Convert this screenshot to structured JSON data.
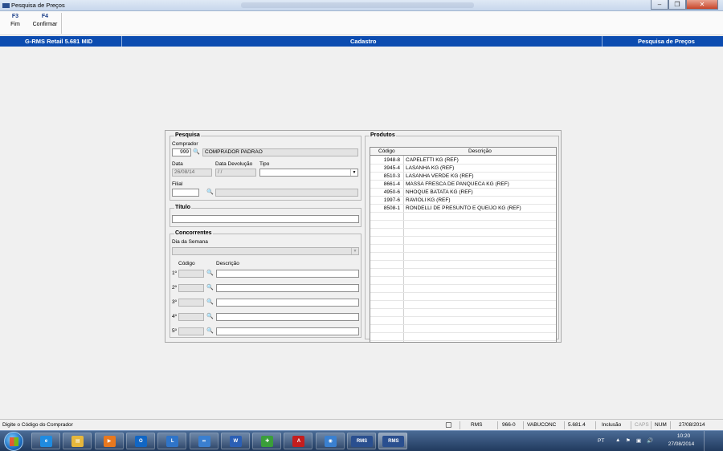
{
  "window": {
    "title": "Pesquisa de Preços"
  },
  "toolbar": {
    "buttons": [
      {
        "key": "F3",
        "label": "Fim"
      },
      {
        "key": "F4",
        "label": "Confirmar"
      }
    ]
  },
  "header": {
    "app": "G-RMS Retail 5.681 MID",
    "module": "Cadastro",
    "screen": "Pesquisa de Preços"
  },
  "pesquisa": {
    "title": "Pesquisa",
    "comprador_label": "Comprador",
    "comprador_code": "999",
    "comprador_name": "COMPRADOR PADRAO",
    "data_label": "Data",
    "data_value": "26/08/14",
    "devolucao_label": "Data Devolução",
    "devolucao_value": " / /",
    "tipo_label": "Tipo",
    "tipo_value": "",
    "filial_label": "Filial",
    "filial_value": "",
    "filial_name": ""
  },
  "titulo": {
    "title": "Título",
    "value": ""
  },
  "concorrentes": {
    "title": "Concorrentes",
    "dia_label": "Dia da Semana",
    "dia_value": "",
    "col_codigo": "Código",
    "col_descricao": "Descrição",
    "rows": [
      {
        "label": "1º",
        "code": "",
        "desc": ""
      },
      {
        "label": "2º",
        "code": "",
        "desc": ""
      },
      {
        "label": "3º",
        "code": "",
        "desc": ""
      },
      {
        "label": "4º",
        "code": "",
        "desc": ""
      },
      {
        "label": "5º",
        "code": "",
        "desc": ""
      }
    ]
  },
  "produtos": {
    "title": "Produtos",
    "col_codigo": "Código",
    "col_descricao": "Descrição",
    "rows": [
      {
        "code": "1948-8",
        "desc": "CAPELETTI KG (REF)"
      },
      {
        "code": "3945-4",
        "desc": "LASANHA KG (REF)"
      },
      {
        "code": "8510-3",
        "desc": "LASANHA VERDE KG (REF)"
      },
      {
        "code": "8661-4",
        "desc": "MASSA FRESCA DE PANQUECA KG (REF)"
      },
      {
        "code": "4950-6",
        "desc": "NHOQUE BATATA KG (REF)"
      },
      {
        "code": "1997-6",
        "desc": "RAVIOLI KG (REF)"
      },
      {
        "code": "8508-1",
        "desc": "RONDELLI DE PRESUNTO E QUEIJO KG (REF)"
      }
    ]
  },
  "status": {
    "message": "Digite o Código do Comprador",
    "system": "RMS",
    "code": "966-0",
    "user": "VABUCONC",
    "version": "5.681.4",
    "mode": "Inclusão",
    "caps": "CAPS",
    "num": "NUM",
    "date": "27/08/2014"
  },
  "taskbar": {
    "items": [
      "ie",
      "explorer",
      "media",
      "outlook",
      "lync",
      "app",
      "word",
      "app2",
      "acrobat",
      "app3",
      "rms",
      "rms"
    ],
    "tray_lang": "PT",
    "time": "10:20",
    "date": "27/08/2014"
  }
}
